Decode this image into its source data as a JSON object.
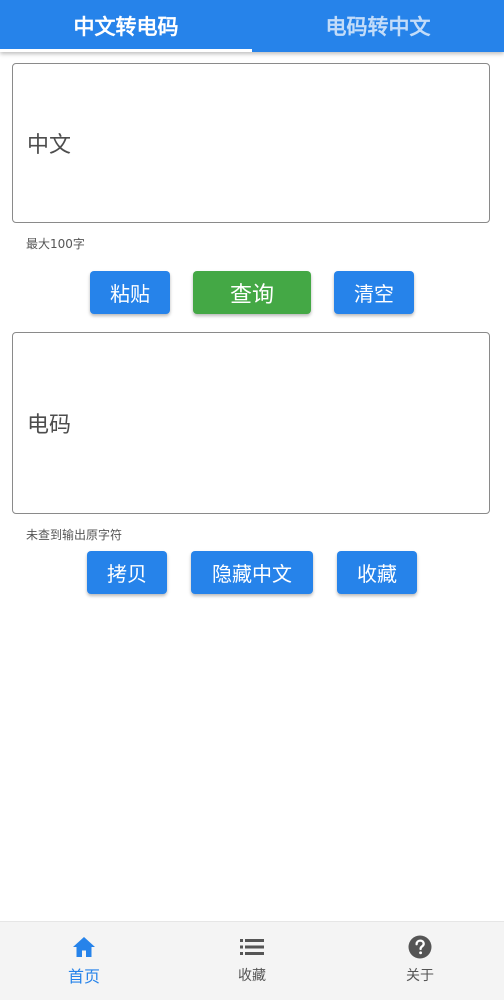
{
  "tabs": {
    "active": "中文转电码",
    "inactive": "电码转中文"
  },
  "chinese_box": {
    "label": "中文",
    "helper": "最大100字"
  },
  "actions_top": {
    "paste": "粘贴",
    "query": "查询",
    "clear": "清空"
  },
  "code_box": {
    "label": "电码",
    "helper": "未查到输出原字符"
  },
  "actions_bottom": {
    "copy": "拷贝",
    "hide_chinese": "隐藏中文",
    "favorite": "收藏"
  },
  "bottom_nav": {
    "home": "首页",
    "favorites": "收藏",
    "about": "关于"
  },
  "colors": {
    "primary": "#2683ea",
    "query_button": "#44a845",
    "nav_background": "#f4f4f4"
  },
  "icons": {
    "home": "home-icon",
    "favorites": "list-icon",
    "about": "help-icon"
  }
}
